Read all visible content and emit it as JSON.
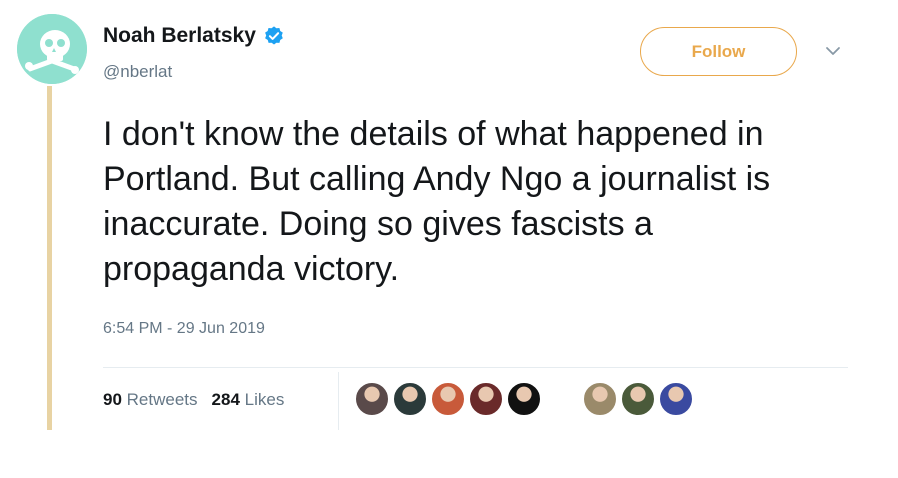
{
  "author": {
    "name": "Noah Berlatsky",
    "handle": "@nberlat",
    "verified": true,
    "avatar_icon": "skull-avatar-icon"
  },
  "actions": {
    "follow_label": "Follow",
    "menu_icon": "chevron-down-icon"
  },
  "tweet": {
    "text": "I don't know the details of what happened in Portland. But calling Andy Ngo a journalist is inaccurate. Doing so gives fascists a propaganda victory.",
    "timestamp": "6:54 PM - 29 Jun 2019"
  },
  "stats": {
    "retweets_count": "90",
    "retweets_label": "Retweets",
    "likes_count": "284",
    "likes_label": "Likes"
  },
  "likers": [
    {
      "name": "liker-avatar-1",
      "color": "#5a4a4a"
    },
    {
      "name": "liker-avatar-2",
      "color": "#2b3a3a"
    },
    {
      "name": "liker-avatar-3",
      "color": "#c85a3a"
    },
    {
      "name": "liker-avatar-4",
      "color": "#6a2a2a"
    },
    {
      "name": "liker-avatar-5",
      "color": "#111111"
    },
    {
      "name": "liker-avatar-6",
      "color": "#ffffff"
    },
    {
      "name": "liker-avatar-7",
      "color": "#9a8a6a"
    },
    {
      "name": "liker-avatar-8",
      "color": "#4a5a3a"
    },
    {
      "name": "liker-avatar-9",
      "color": "#3a4aa0"
    }
  ],
  "colors": {
    "accent": "#e9a84c",
    "avatar_bg": "#8fe0cf",
    "thread_line": "#e8d3a3",
    "verified_blue": "#1da1f2"
  }
}
